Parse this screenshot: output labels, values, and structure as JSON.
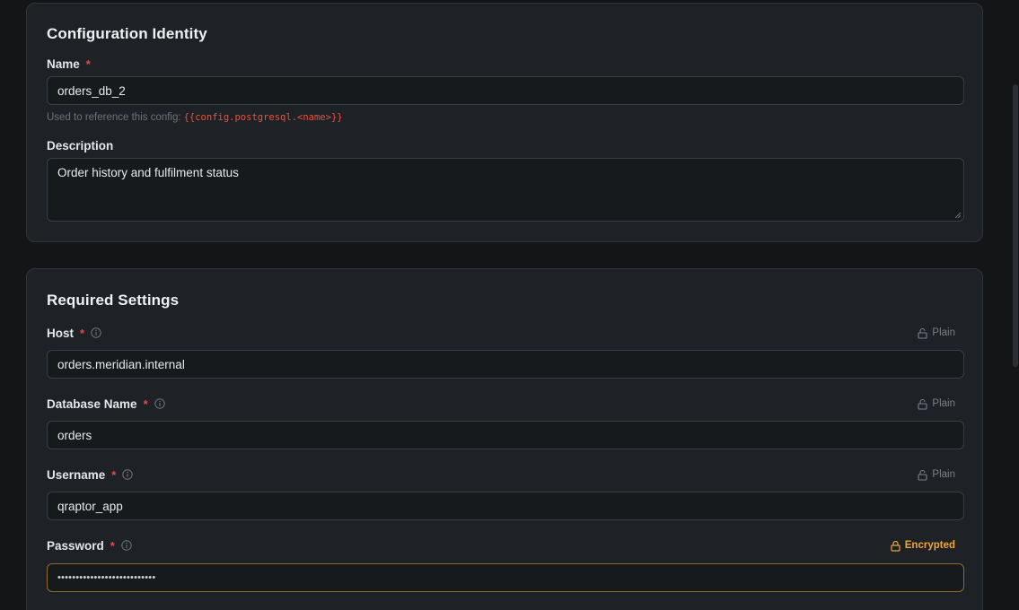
{
  "identity": {
    "title": "Configuration Identity",
    "name_label": "Name",
    "name_required": "*",
    "name_value": "orders_db_2",
    "hint_text": "Used to reference this config:",
    "hint_code": "{{config.postgresql.<name>}}",
    "description_label": "Description",
    "description_value": "Order history and fulfilment status"
  },
  "required": {
    "title": "Required Settings",
    "fields": [
      {
        "label": "Host",
        "required": "*",
        "badge": "Plain",
        "value": "orders.meridian.internal"
      },
      {
        "label": "Database Name",
        "required": "*",
        "badge": "Plain",
        "value": "orders"
      },
      {
        "label": "Username",
        "required": "*",
        "badge": "Plain",
        "value": "qraptor_app"
      },
      {
        "label": "Password",
        "required": "*",
        "badge": "Encrypted",
        "value": "•••••••••••••••••••••••••••"
      }
    ]
  },
  "colors": {
    "background": "#131517",
    "card": "#1e2227",
    "required_star": "#e5484d",
    "encrypted": "#f0a43a",
    "code": "#e5533f"
  },
  "icons": {
    "info": "info-circle-icon",
    "plain": "lock-open-icon",
    "encrypted": "lock-icon"
  }
}
